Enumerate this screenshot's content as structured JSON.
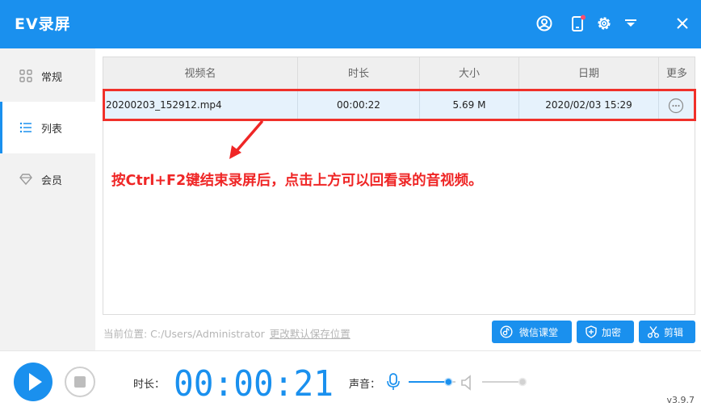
{
  "app": {
    "title": "EV录屏"
  },
  "titlebar_icons": [
    "user-icon",
    "phone-icon",
    "gear-icon",
    "dropdown-icon",
    "close-icon"
  ],
  "sidebar": {
    "items": [
      {
        "label": "常规",
        "icon": "grid-icon",
        "active": false
      },
      {
        "label": "列表",
        "icon": "list-icon",
        "active": true
      },
      {
        "label": "会员",
        "icon": "diamond-icon",
        "active": false
      }
    ]
  },
  "table": {
    "columns": [
      "视频名",
      "时长",
      "大小",
      "日期",
      "更多"
    ],
    "rows": [
      {
        "name": "20200203_152912.mp4",
        "duration": "00:00:22",
        "size": "5.69 M",
        "date": "2020/02/03 15:29"
      }
    ]
  },
  "annotation": "按Ctrl+F2键结束录屏后，点击上方可以回看录的音视频。",
  "path": {
    "label": "当前位置: C:/Users/Administrator",
    "change_link": "更改默认保存位置"
  },
  "actions": {
    "wechat_label": "微信课堂",
    "encrypt_label": "加密",
    "cut_label": "剪辑"
  },
  "controls": {
    "duration_label": "时长：",
    "timer": "00:00:21",
    "sound_label": "声音：",
    "mic_volume": 0.85,
    "speaker_volume": 1.0
  },
  "version": "v3.9.7",
  "colors": {
    "accent": "#1a90ee",
    "annotation": "#ef2626",
    "row_selected": "#e6f2fc"
  }
}
